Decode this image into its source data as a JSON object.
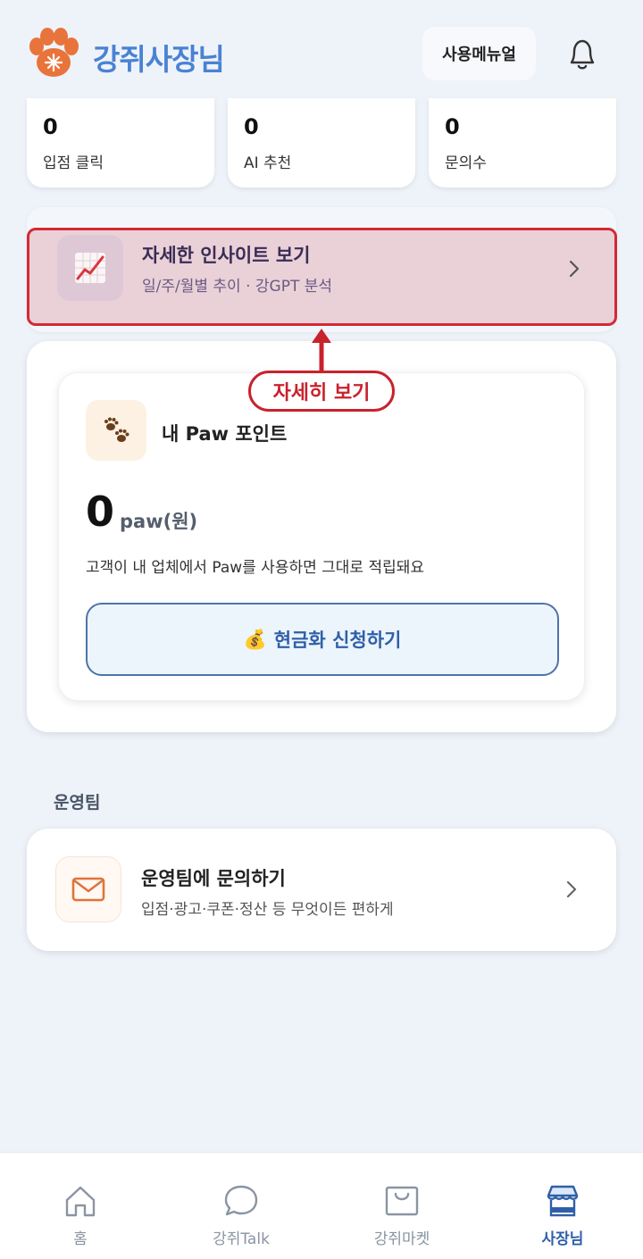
{
  "header": {
    "app_name": "강쥐사장님",
    "manual_label": "사용메뉴얼"
  },
  "stats": [
    {
      "value": "0",
      "label": "입점 클릭"
    },
    {
      "value": "0",
      "label": "AI 추천"
    },
    {
      "value": "0",
      "label": "문의수"
    }
  ],
  "insight": {
    "title": "자세한 인사이트 보기",
    "subtitle": "일/주/월별 추이 · 강GPT 분석"
  },
  "callout": {
    "label": "자세히 보기"
  },
  "paw": {
    "title": "내 Paw 포인트",
    "amount": "0",
    "unit": "paw(원)",
    "description": "고객이 내 업체에서 Paw를 사용하면 그대로 적립돼요",
    "cash_button_icon": "💰",
    "cash_button_label": "현금화 신청하기"
  },
  "ops": {
    "section_title": "운영팀",
    "title": "운영팀에 문의하기",
    "subtitle": "입점·광고·쿠폰·정산 등 무엇이든 편하게"
  },
  "nav": [
    {
      "label": "홈",
      "icon": "home-icon",
      "active": false
    },
    {
      "label": "강쥐Talk",
      "icon": "chat-icon",
      "active": false
    },
    {
      "label": "강쥐마켓",
      "icon": "shopping-bag-icon",
      "active": false
    },
    {
      "label": "사장님",
      "icon": "store-icon",
      "active": true
    }
  ],
  "colors": {
    "brand": "#4a82d4",
    "highlight": "#d32a35",
    "active_nav": "#2f5fa8"
  }
}
